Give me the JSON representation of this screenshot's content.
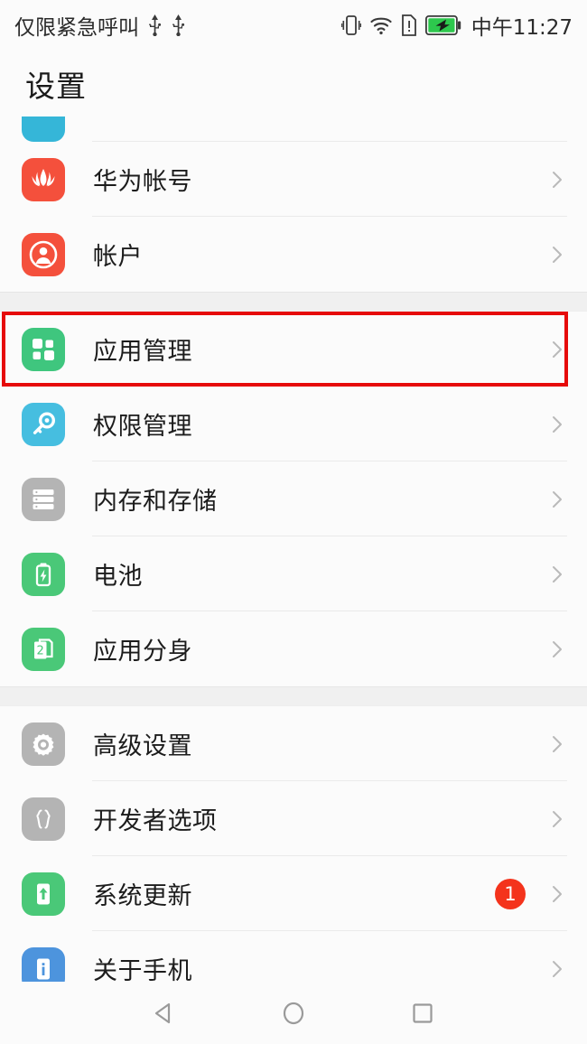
{
  "statusbar": {
    "carrier_text": "仅限紧急呼叫",
    "clock": "中午11:27",
    "icons_left": [
      "usb-icon",
      "usb-icon"
    ],
    "icons_right": [
      "vibrate-icon",
      "wifi-icon",
      "sim-alert-icon",
      "battery-charging-icon"
    ],
    "battery_color": "#2dc84d"
  },
  "header": {
    "title": "设置"
  },
  "groups": [
    {
      "name": "accounts-group",
      "items": [
        {
          "label": "",
          "icon": "cyan-partial-icon",
          "icon_color": "#35b6d8",
          "partial": true,
          "badge": "",
          "chevron": false
        },
        {
          "label": "华为帐号",
          "icon": "huawei-flower-icon",
          "icon_color": "#f4503c",
          "partial": false,
          "badge": "",
          "chevron": true
        },
        {
          "label": "帐户",
          "icon": "account-person-icon",
          "icon_color": "#f4503c",
          "partial": false,
          "badge": "",
          "chevron": true
        }
      ]
    },
    {
      "name": "apps-group",
      "items": [
        {
          "label": "应用管理",
          "icon": "app-grid-icon",
          "icon_color": "#3fc67e",
          "partial": false,
          "badge": "",
          "chevron": true,
          "highlighted": true
        },
        {
          "label": "权限管理",
          "icon": "key-icon",
          "icon_color": "#46bee0",
          "partial": false,
          "badge": "",
          "chevron": true
        },
        {
          "label": "内存和存储",
          "icon": "storage-icon",
          "icon_color": "#b4b4b4",
          "partial": false,
          "badge": "",
          "chevron": true
        },
        {
          "label": "电池",
          "icon": "battery-icon",
          "icon_color": "#4ac878",
          "partial": false,
          "badge": "",
          "chevron": true
        },
        {
          "label": "应用分身",
          "icon": "app-twin-icon",
          "icon_color": "#4ac878",
          "partial": false,
          "badge": "",
          "chevron": true
        }
      ]
    },
    {
      "name": "system-group",
      "items": [
        {
          "label": "高级设置",
          "icon": "gear-icon",
          "icon_color": "#b4b4b4",
          "partial": false,
          "badge": "",
          "chevron": true
        },
        {
          "label": "开发者选项",
          "icon": "braces-icon",
          "icon_color": "#b4b4b4",
          "partial": false,
          "badge": "",
          "chevron": true
        },
        {
          "label": "系统更新",
          "icon": "system-update-icon",
          "icon_color": "#4ac878",
          "partial": false,
          "badge": "1",
          "chevron": true
        },
        {
          "label": "关于手机",
          "icon": "about-phone-icon",
          "icon_color": "#4d94dd",
          "partial": false,
          "badge": "",
          "chevron": true
        }
      ]
    }
  ],
  "navbar": {
    "back": "back-triangle-icon",
    "home": "home-circle-icon",
    "recents": "recents-square-icon"
  },
  "highlight": {
    "color": "#e60a0a",
    "target_label": "应用管理"
  }
}
